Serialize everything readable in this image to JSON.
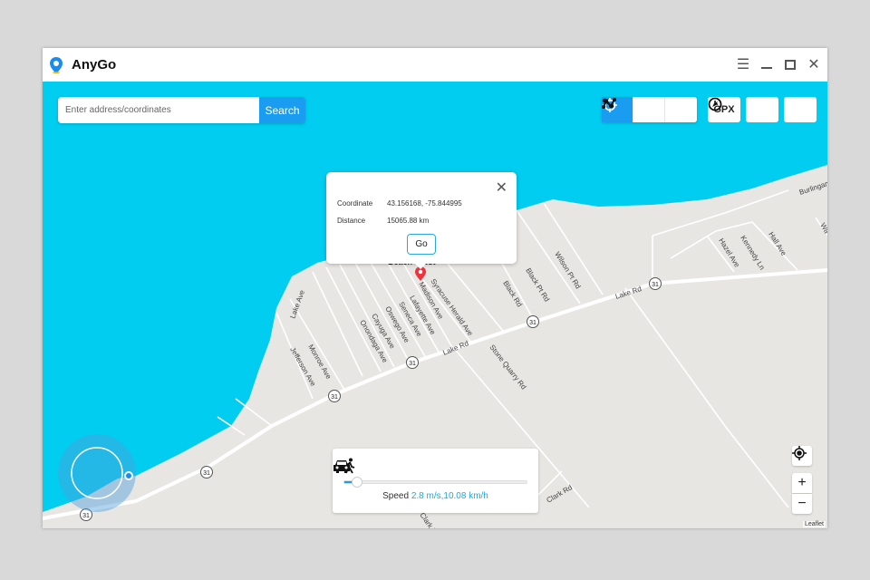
{
  "app": {
    "title": "AnyGo",
    "accent": "#1a9cf0",
    "water": "#00cdf0",
    "land": "#e8e6e3"
  },
  "window_controls": [
    "menu-icon",
    "minimize-icon",
    "maximize-icon",
    "close-icon"
  ],
  "search": {
    "placeholder": "Enter address/coordinates",
    "button": "Search"
  },
  "toolbar": {
    "modes": [
      "teleport-icon",
      "two-spot-icon",
      "multi-spot-icon"
    ],
    "active_mode": 0,
    "gpx": "GPX",
    "history": "clock-icon",
    "compass": "compass-icon"
  },
  "popup": {
    "coord_label": "Coordinate",
    "coord_value": "43.156168, -75.844995",
    "dist_label": "Distance",
    "dist_value": "15065.88 km",
    "go": "Go"
  },
  "speed": {
    "label": "Speed",
    "value": "2.8 m/s,10.08 km/h",
    "fraction": 0.07
  },
  "map": {
    "place": "Beach Crest",
    "roads": [
      "Lake Rd",
      "Lake Rd",
      "Lake Ave",
      "Monroe Ave",
      "Jefferson Ave",
      "Onondaga Ave",
      "Cayuga Ave",
      "Oswego Ave",
      "Seneca Ave",
      "Lafayette Ave",
      "Madison Ave",
      "Syracuse Herald Ave",
      "Black Rd",
      "Black Pt Rd",
      "Wilson Pt Rd",
      "Stone Quarry Rd",
      "Hazel Ave",
      "Kennedy Ln",
      "Hall Ave",
      "Burlingame",
      "Wa",
      "Clark Rd",
      "Clark Rd"
    ],
    "route_shield": "31",
    "zoom_in": "+",
    "zoom_out": "−",
    "attribution": "Leaflet"
  }
}
